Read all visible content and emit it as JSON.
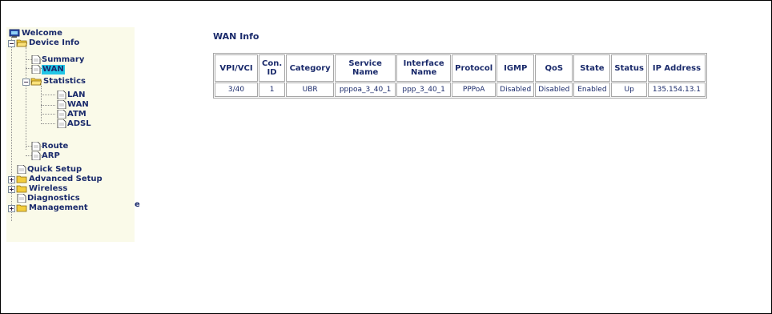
{
  "sidebar": {
    "items": {
      "welcome": "Welcome",
      "device_info": "Device Info",
      "summary": "Summary",
      "wan": "WAN",
      "statistics": "Statistics",
      "lan": "LAN",
      "stat_wan": "WAN",
      "atm": "ATM",
      "adsl": "ADSL",
      "route": "Route",
      "arp": "ARP",
      "quick_setup": "Quick Setup",
      "advanced_setup": "Advanced Setup",
      "wireless": "Wireless",
      "diagnostics": "Diagnostics",
      "management": "Management"
    },
    "stray_text": "e",
    "expander_minus": "−",
    "expander_plus": "+"
  },
  "main": {
    "title": "WAN Info",
    "table": {
      "headers": [
        "VPI/VCI",
        "Con. ID",
        "Category",
        "Service Name",
        "Interface Name",
        "Protocol",
        "IGMP",
        "QoS",
        "State",
        "Status",
        "IP Address"
      ],
      "rows": [
        [
          "3/40",
          "1",
          "UBR",
          "pppoa_3_40_1",
          "ppp_3_40_1",
          "PPPoA",
          "Disabled",
          "Disabled",
          "Enabled",
          "Up",
          "135.154.13.1"
        ]
      ]
    }
  },
  "colors": {
    "text": "#1a2a6b",
    "selection": "#23c6e6",
    "sidebar_bg": "#fafae9",
    "folder": "#f3cd3c",
    "border": "#a7a7a7"
  }
}
